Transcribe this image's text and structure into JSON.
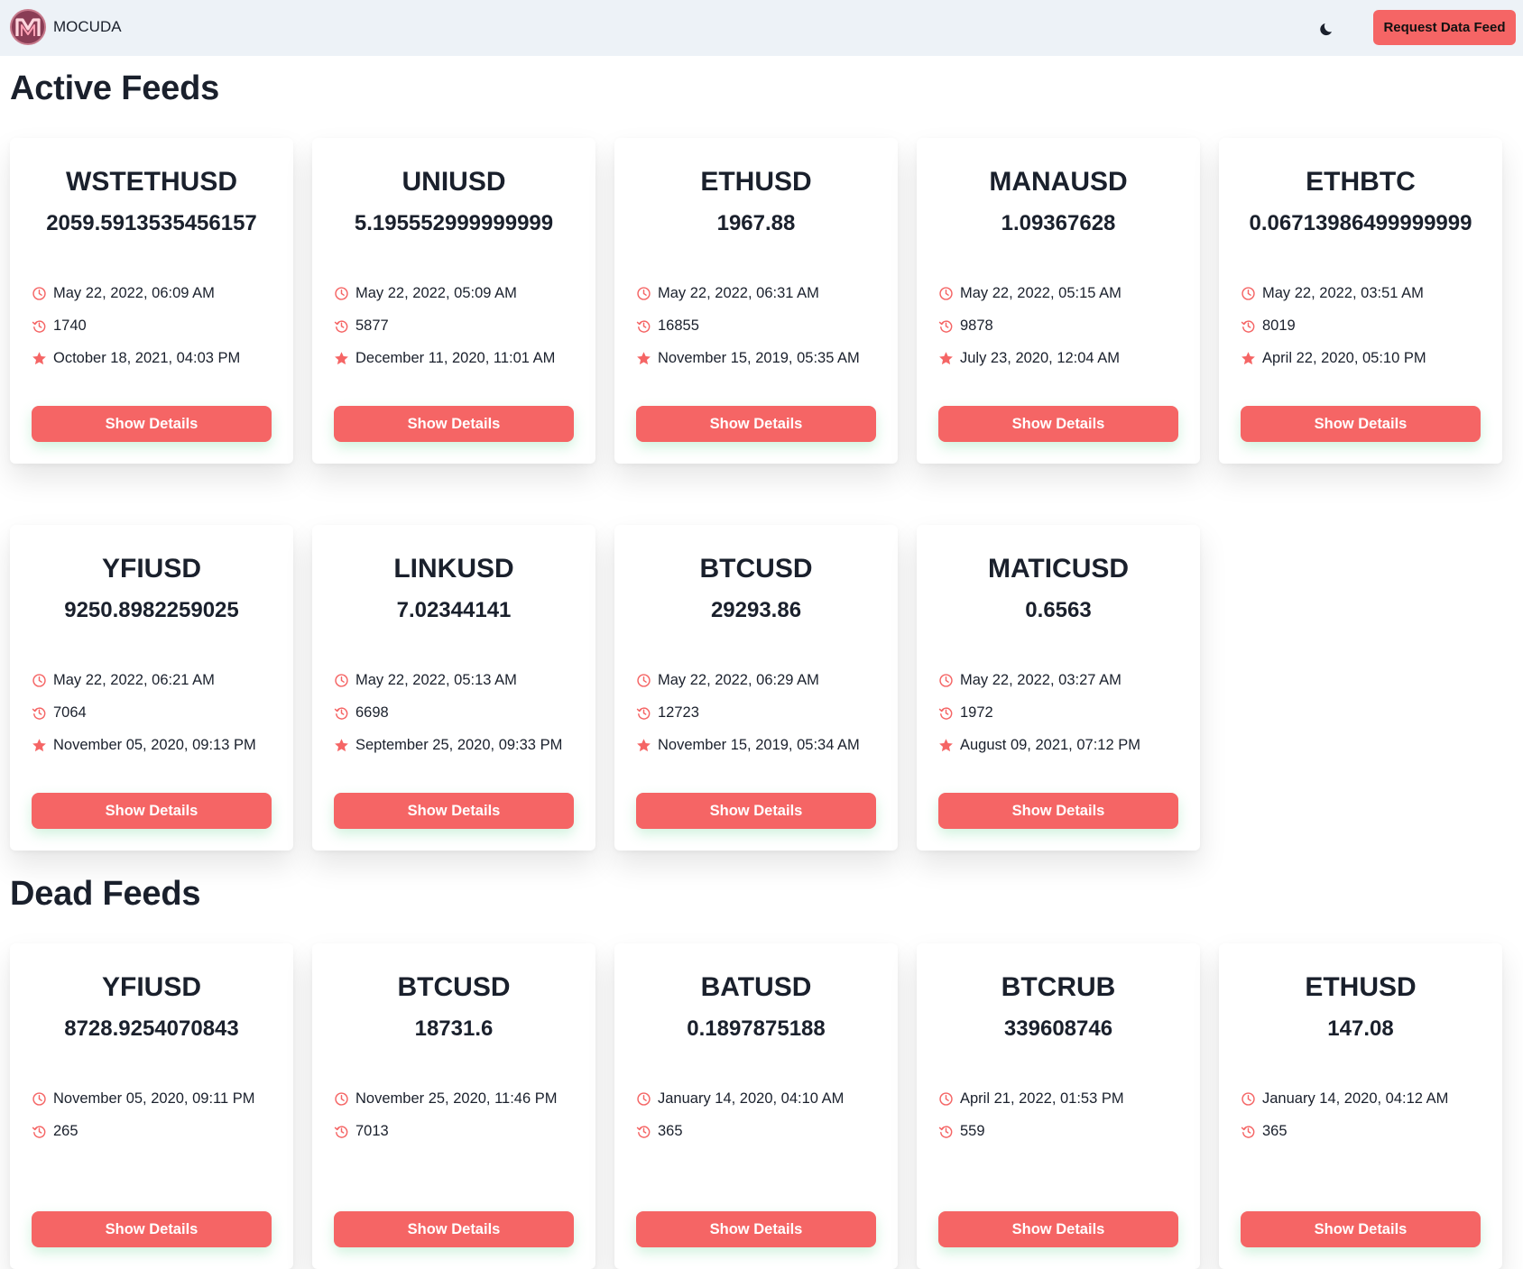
{
  "brand": {
    "name": "MOCUDA"
  },
  "header": {
    "request_label": "Request Data Feed"
  },
  "sections": {
    "active": {
      "title": "Active Feeds"
    },
    "dead": {
      "title": "Dead Feeds"
    }
  },
  "button_label": "Show Details",
  "colors": {
    "accent": "#f56565",
    "navbar": "#edf2f7",
    "text": "#1a202c"
  },
  "icons": {
    "updated": "clock-icon",
    "rounds": "history-icon",
    "created": "star-icon",
    "theme": "moon-icon"
  },
  "active_feeds": [
    {
      "pair": "WSTETHUSD",
      "price": "2059.5913535456157",
      "updated": "May 22, 2022, 06:09 AM",
      "rounds": "1740",
      "created": "October 18, 2021, 04:03 PM"
    },
    {
      "pair": "UNIUSD",
      "price": "5.195552999999999",
      "updated": "May 22, 2022, 05:09 AM",
      "rounds": "5877",
      "created": "December 11, 2020, 11:01 AM"
    },
    {
      "pair": "ETHUSD",
      "price": "1967.88",
      "updated": "May 22, 2022, 06:31 AM",
      "rounds": "16855",
      "created": "November 15, 2019, 05:35 AM"
    },
    {
      "pair": "MANAUSD",
      "price": "1.09367628",
      "updated": "May 22, 2022, 05:15 AM",
      "rounds": "9878",
      "created": "July 23, 2020, 12:04 AM"
    },
    {
      "pair": "ETHBTC",
      "price": "0.06713986499999999",
      "updated": "May 22, 2022, 03:51 AM",
      "rounds": "8019",
      "created": "April 22, 2020, 05:10 PM"
    },
    {
      "pair": "YFIUSD",
      "price": "9250.8982259025",
      "updated": "May 22, 2022, 06:21 AM",
      "rounds": "7064",
      "created": "November 05, 2020, 09:13 PM"
    },
    {
      "pair": "LINKUSD",
      "price": "7.02344141",
      "updated": "May 22, 2022, 05:13 AM",
      "rounds": "6698",
      "created": "September 25, 2020, 09:33 PM"
    },
    {
      "pair": "BTCUSD",
      "price": "29293.86",
      "updated": "May 22, 2022, 06:29 AM",
      "rounds": "12723",
      "created": "November 15, 2019, 05:34 AM"
    },
    {
      "pair": "MATICUSD",
      "price": "0.6563",
      "updated": "May 22, 2022, 03:27 AM",
      "rounds": "1972",
      "created": "August 09, 2021, 07:12 PM"
    }
  ],
  "dead_feeds": [
    {
      "pair": "YFIUSD",
      "price": "8728.9254070843",
      "updated": "November 05, 2020, 09:11 PM",
      "rounds": "265",
      "created": ""
    },
    {
      "pair": "BTCUSD",
      "price": "18731.6",
      "updated": "November 25, 2020, 11:46 PM",
      "rounds": "7013",
      "created": ""
    },
    {
      "pair": "BATUSD",
      "price": "0.1897875188",
      "updated": "January 14, 2020, 04:10 AM",
      "rounds": "365",
      "created": ""
    },
    {
      "pair": "BTCRUB",
      "price": "339608746",
      "updated": "April 21, 2022, 01:53 PM",
      "rounds": "559",
      "created": ""
    },
    {
      "pair": "ETHUSD",
      "price": "147.08",
      "updated": "January 14, 2020, 04:12 AM",
      "rounds": "365",
      "created": ""
    }
  ]
}
